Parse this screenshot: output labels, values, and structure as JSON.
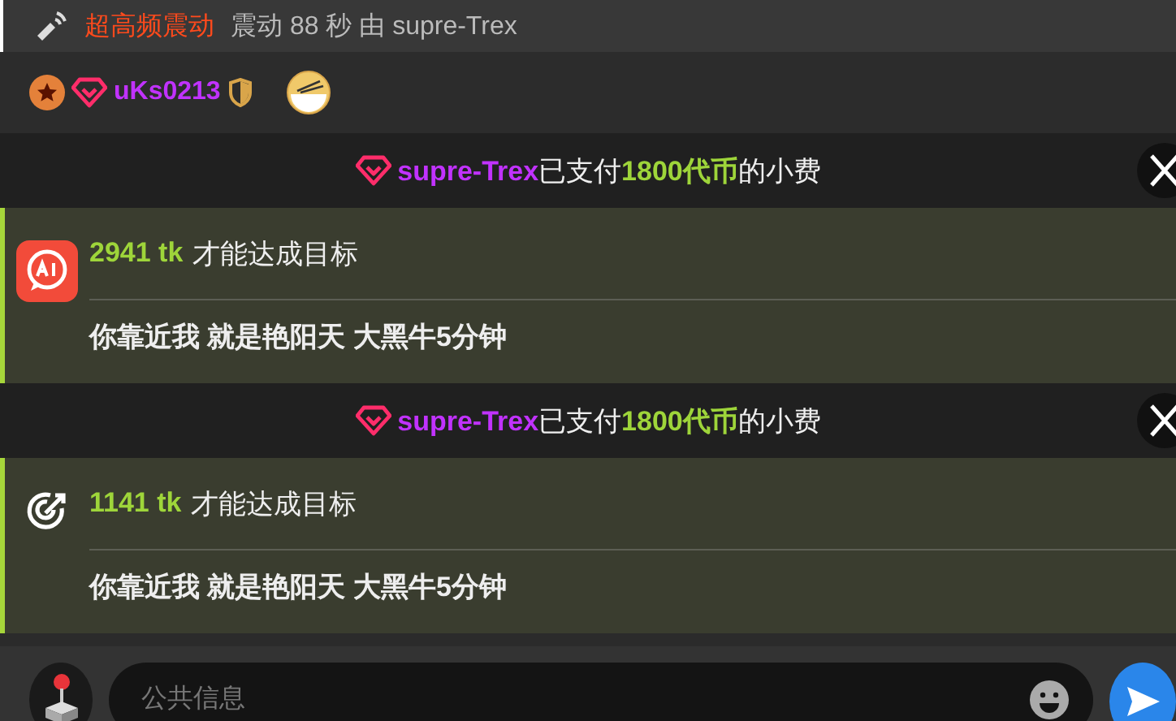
{
  "vibration_notice": {
    "label": "超高频震动",
    "text": "震动 88 秒 由 supre-Trex"
  },
  "user": {
    "name": "uKs0213"
  },
  "feed": [
    {
      "kind": "tip",
      "user": "supre-Trex",
      "paid": "已支付",
      "amount": "1800代币",
      "suffix": "的小费"
    },
    {
      "kind": "goal",
      "amount": "2941 tk",
      "text": "才能达成目标",
      "title": "你靠近我 就是艳阳天 大黑牛5分钟"
    },
    {
      "kind": "tip",
      "user": "supre-Trex",
      "paid": "已支付",
      "amount": "1800代币",
      "suffix": "的小费"
    },
    {
      "kind": "goal",
      "amount": "1141 tk",
      "text": "才能达成目标",
      "title": "你靠近我 就是艳阳天 大黑牛5分钟"
    }
  ],
  "composer": {
    "placeholder": "公共信息"
  }
}
